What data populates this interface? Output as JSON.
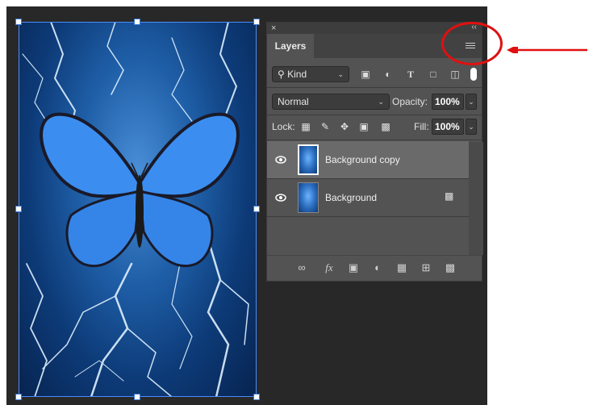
{
  "panel": {
    "tab_label": "Layers",
    "close_glyph": "×",
    "collapse_glyph": "‹‹",
    "filter": {
      "value": "Kind",
      "icons": [
        "image-filter-icon",
        "adjustment-filter-icon",
        "type-filter-icon",
        "shape-filter-icon",
        "smart-object-filter-icon"
      ]
    },
    "blend_mode": "Normal",
    "opacity_label": "Opacity:",
    "opacity_value": "100%",
    "lock_label": "Lock:",
    "fill_label": "Fill:",
    "fill_value": "100%",
    "layers": [
      {
        "name": "Background copy",
        "selected": true,
        "locked": false
      },
      {
        "name": "Background",
        "selected": false,
        "locked": true
      }
    ],
    "footer_icons": [
      "link-layers-icon",
      "fx-icon",
      "add-mask-icon",
      "adjustment-layer-icon",
      "new-group-icon",
      "new-layer-icon",
      "delete-layer-icon"
    ],
    "fx_label": "fx"
  },
  "colors": {
    "annotation": "#e01010",
    "selection": "#4a8cff",
    "panel_bg": "#535353",
    "canvas_bg": "#282828"
  }
}
